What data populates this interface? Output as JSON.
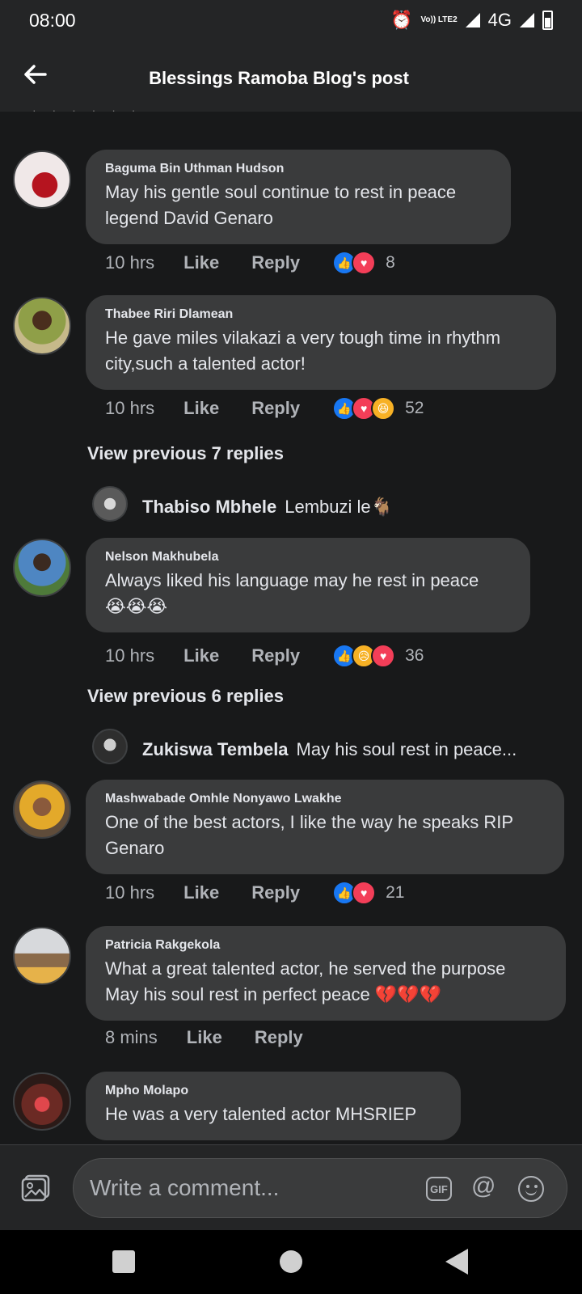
{
  "status_bar": {
    "time": "08:00",
    "network": "4G",
    "lte_label": "Vo)) LTE2"
  },
  "header": {
    "title": "Blessings Ramoba Blog's post"
  },
  "feed": {
    "top_dots": "· · · · · ·",
    "comments": [
      {
        "name": "Baguma Bin Uthman Hudson",
        "text_lines": [
          "May his gentle soul continue to rest in peace",
          "legend David Genaro"
        ],
        "time": "10 hrs",
        "like": "Like",
        "reply": "Reply",
        "reactions": [
          "like",
          "love"
        ],
        "count": "8"
      },
      {
        "name": "Thabee Riri Dlamean",
        "text_lines": [
          "He gave miles vilakazi a very tough time in rhythm",
          "city,such a talented actor!"
        ],
        "time": "10 hrs",
        "like": "Like",
        "reply": "Reply",
        "reactions": [
          "like",
          "love",
          "haha"
        ],
        "count": "52",
        "view_previous": "View previous 7 replies",
        "reply_preview": {
          "name": "Thabiso Mbhele",
          "text": "Lembuzi le🐐"
        }
      },
      {
        "name": "Nelson Makhubela",
        "text_lines": [
          "Always liked his language may he rest in peace",
          "😭😭😭"
        ],
        "time": "10 hrs",
        "like": "Like",
        "reply": "Reply",
        "reactions": [
          "like",
          "sad",
          "love"
        ],
        "count": "36",
        "view_previous": "View previous 6 replies",
        "reply_preview": {
          "name": "Zukiswa Tembela",
          "text": "May his soul rest in peace..."
        }
      },
      {
        "name": "Mashwabade Omhle Nonyawo Lwakhe",
        "text_lines": [
          "One of the best actors, I like the way he speaks RIP",
          "Genaro"
        ],
        "time": "10 hrs",
        "like": "Like",
        "reply": "Reply",
        "reactions": [
          "like",
          "love"
        ],
        "count": "21"
      },
      {
        "name": "Patricia Rakgekola",
        "text_lines": [
          "What a great talented actor, he served the purpose",
          "May his soul rest in perfect peace 💔💔💔"
        ],
        "time": "8 mins",
        "like": "Like",
        "reply": "Reply"
      },
      {
        "name": "Mpho Molapo",
        "text_lines": [
          "He was a very talented actor MHSRIEP"
        ]
      }
    ]
  },
  "composer": {
    "placeholder": "Write a comment...",
    "gif_label": "GIF",
    "mention_label": "@"
  },
  "colors": {
    "background": "#18191a",
    "bubble": "#3a3b3c",
    "like_blue": "#1877f2",
    "love_red": "#f33e58",
    "reaction_yellow": "#f7b125"
  }
}
